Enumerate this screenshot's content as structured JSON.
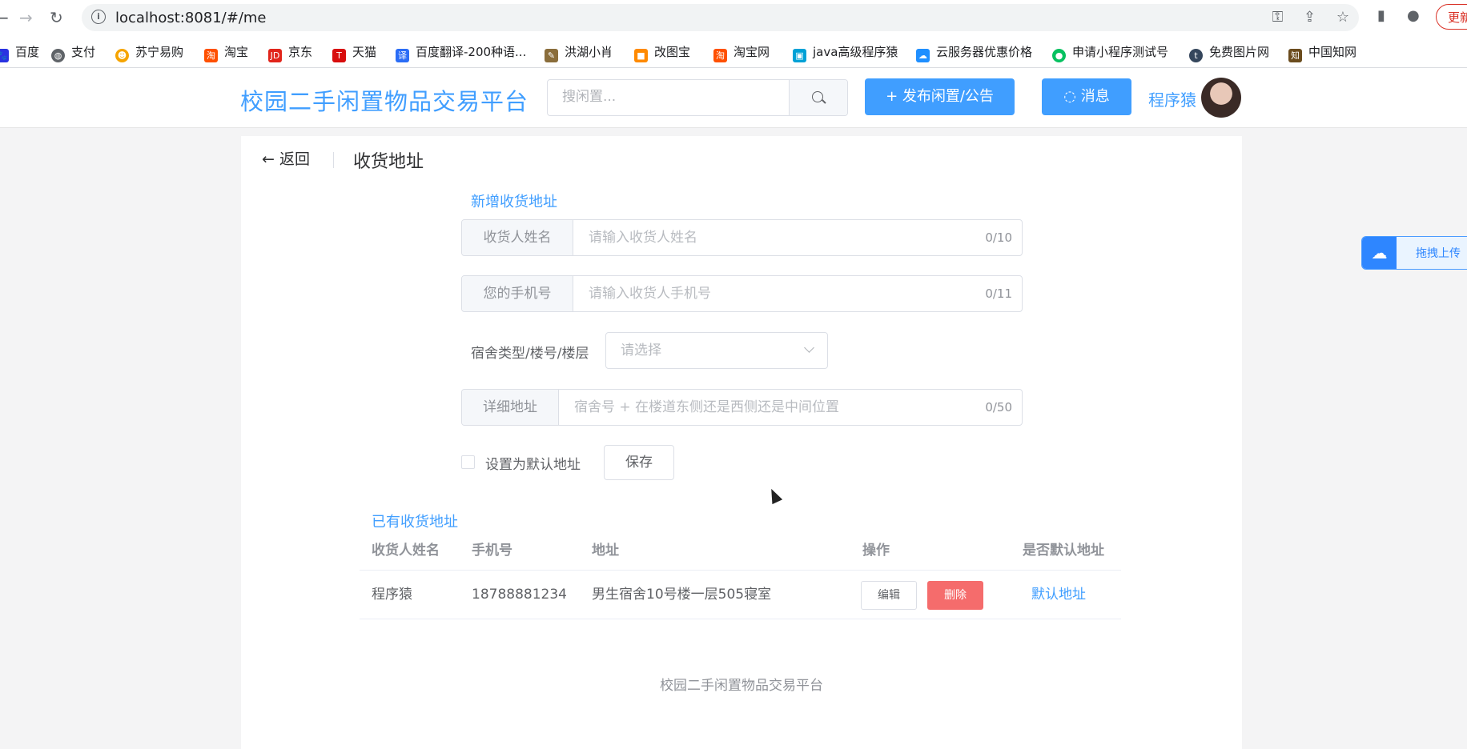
{
  "browser": {
    "url": "localhost:8081/#/me",
    "update_label": "更新",
    "bookmarks": [
      {
        "label": "百度",
        "color": "#2932e1"
      },
      {
        "label": "支付",
        "color": "#5f6368"
      },
      {
        "label": "苏宁易购",
        "color": "#f6a400"
      },
      {
        "label": "淘宝",
        "color": "#ff5000"
      },
      {
        "label": "京东",
        "color": "#e1251b"
      },
      {
        "label": "天猫",
        "color": "#d80d0d"
      },
      {
        "label": "百度翻译-200种语...",
        "color": "#2b6df6"
      },
      {
        "label": "洪湖小肖",
        "color": "#8a6d3b"
      },
      {
        "label": "改图宝",
        "color": "#ff8a00"
      },
      {
        "label": "淘宝网",
        "color": "#ff5000"
      },
      {
        "label": "java高级程序猿",
        "color": "#00a1d6"
      },
      {
        "label": "云服务器优惠价格",
        "color": "#1f8fff"
      },
      {
        "label": "申请小程序测试号",
        "color": "#07c160"
      },
      {
        "label": "免费图片网",
        "color": "#35465c"
      },
      {
        "label": "中国知网",
        "color": "#6b4c1e"
      }
    ]
  },
  "header": {
    "site_title": "校园二手闲置物品交易平台",
    "search_placeholder": "搜闲置...",
    "publish_label": "+ 发布闲置/公告",
    "message_label": "消息",
    "user_name": "程序猿"
  },
  "page": {
    "back_label": "返回",
    "title": "收货地址"
  },
  "form": {
    "section_title": "新增收货地址",
    "name": {
      "label": "收货人姓名",
      "placeholder": "请输入收货人姓名",
      "counter": "0/10"
    },
    "phone": {
      "label": "您的手机号",
      "placeholder": "请输入收货人手机号",
      "counter": "0/11"
    },
    "dorm": {
      "label": "宿舍类型/楼号/楼层",
      "placeholder": "请选择"
    },
    "detail": {
      "label": "详细地址",
      "placeholder": "宿舍号 + 在楼道东侧还是西侧还是中间位置",
      "counter": "0/50"
    },
    "default_checkbox_label": "设置为默认地址",
    "save_label": "保存"
  },
  "table": {
    "section_title": "已有收货地址",
    "headers": [
      "收货人姓名",
      "手机号",
      "地址",
      "操作",
      "是否默认地址"
    ],
    "rows": [
      {
        "name": "程序猿",
        "phone": "18788881234",
        "address": "男生宿舍10号楼一层505寝室",
        "edit_label": "编辑",
        "delete_label": "删除",
        "default_label": "默认地址"
      }
    ]
  },
  "footer": "校园二手闲置物品交易平台",
  "upload_widget": {
    "label": "拖拽上传"
  },
  "colors": {
    "primary": "#409eff",
    "danger": "#f56c6c"
  }
}
